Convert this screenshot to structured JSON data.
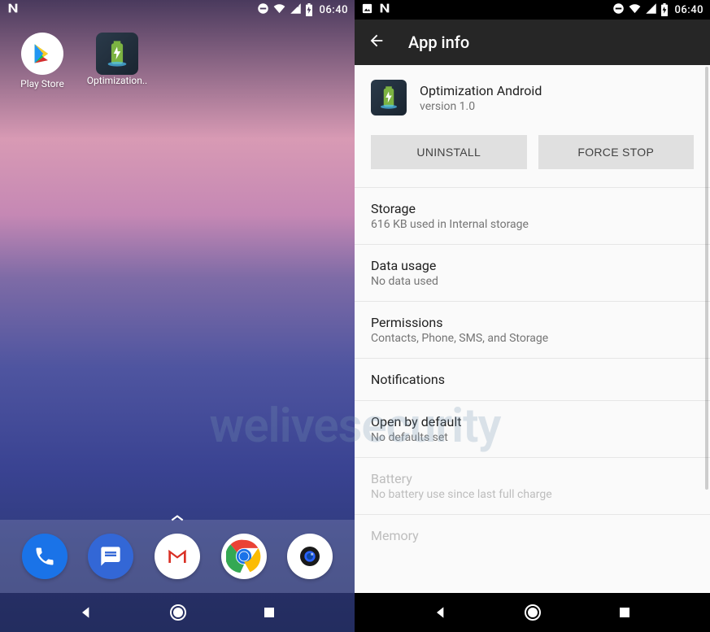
{
  "watermark": "welivesecurity",
  "left": {
    "status_time": "06:40",
    "apps": [
      {
        "label": "Play Store"
      },
      {
        "label": "Optimization.."
      }
    ],
    "dock": [
      "Phone",
      "Messages",
      "Gmail",
      "Chrome",
      "Camera"
    ]
  },
  "right": {
    "status_time": "06:40",
    "toolbar_title": "App info",
    "app": {
      "name": "Optimization Android",
      "version": "version 1.0"
    },
    "buttons": {
      "uninstall": "UNINSTALL",
      "force_stop": "FORCE STOP"
    },
    "items": [
      {
        "primary": "Storage",
        "secondary": "616 KB used in Internal storage"
      },
      {
        "primary": "Data usage",
        "secondary": "No data used"
      },
      {
        "primary": "Permissions",
        "secondary": "Contacts, Phone, SMS, and Storage"
      },
      {
        "primary": "Notifications",
        "secondary": ""
      },
      {
        "primary": "Open by default",
        "secondary": "No defaults set"
      },
      {
        "primary": "Battery",
        "secondary": "No battery use since last full charge",
        "disabled": true
      },
      {
        "primary": "Memory",
        "secondary": "",
        "disabled": true
      }
    ]
  }
}
